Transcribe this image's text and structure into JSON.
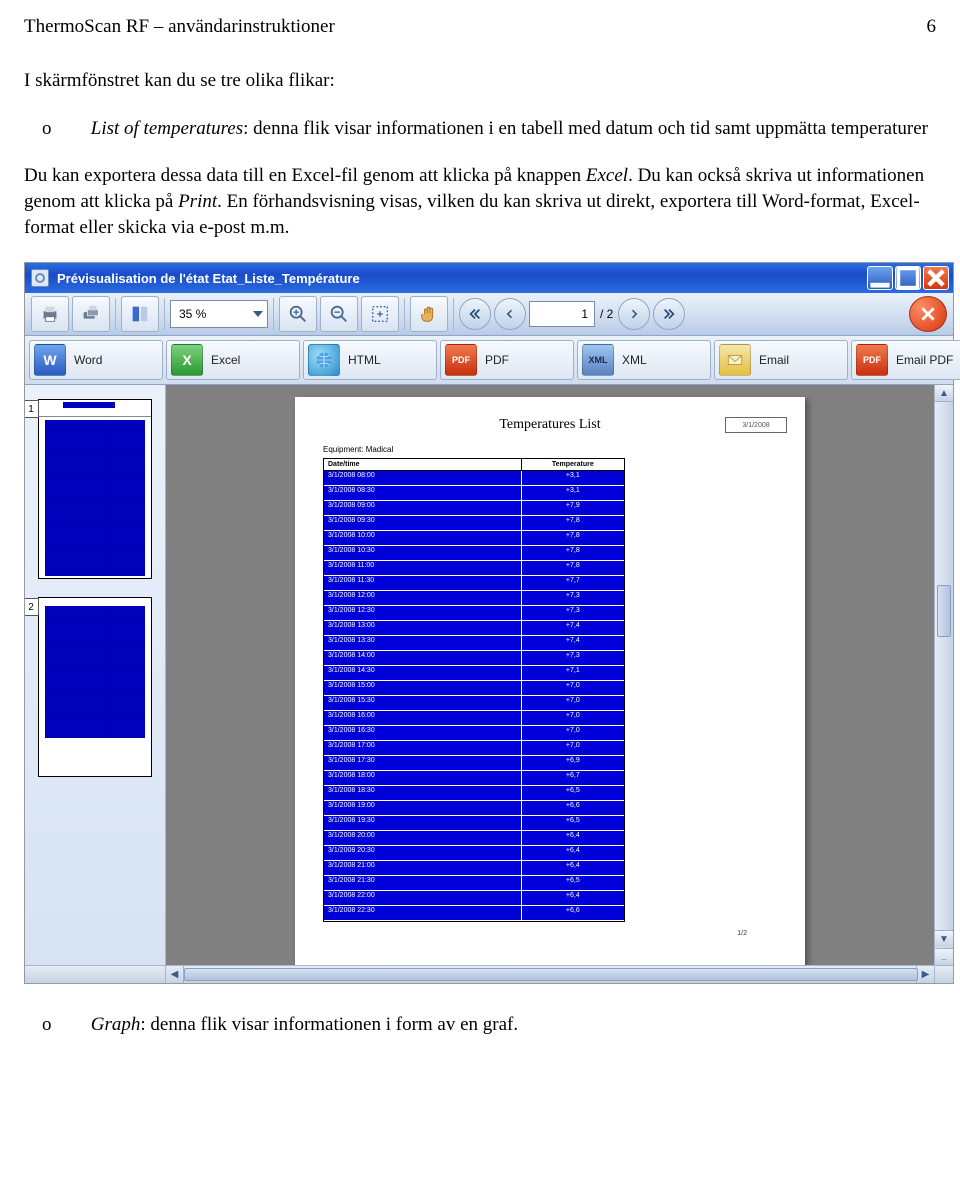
{
  "doc": {
    "header_left": "ThermoScan RF – användarinstruktioner",
    "header_right": "6",
    "intro": "I skärmfönstret kan du se tre olika flikar:",
    "bullet1_prefix": "o",
    "bullet1_label": "List of temperatures",
    "bullet1_rest": ": denna flik visar informationen i en tabell med datum och tid samt uppmätta temperaturer",
    "middle_part1": "Du kan exportera dessa data till en Excel-fil genom att klicka på knappen ",
    "middle_em1": "Excel",
    "middle_part2": ". Du kan också skriva ut informationen genom att klicka på ",
    "middle_em2": "Print",
    "middle_part3": ". En förhandsvisning visas, vilken du kan skriva ut direkt, exportera till Word-format, Excel-format eller skicka via e-post m.m.",
    "bullet2_prefix": "o",
    "bullet2_label": "Graph",
    "bullet2_rest": ": denna flik visar informationen i form av en graf."
  },
  "app": {
    "title": "Prévisualisation de l'état Etat_Liste_Température",
    "toolbar": {
      "zoom": "35 %",
      "page_current": "1",
      "page_suffix": "/ 2"
    },
    "export": {
      "word": "Word",
      "excel": "Excel",
      "html": "HTML",
      "pdf": "PDF",
      "xml": "XML",
      "email": "Email",
      "email_pdf": "Email PDF"
    },
    "thumbs": {
      "p1": "1",
      "p2": "2"
    },
    "preview": {
      "title": "Temperatures List",
      "corner": "3/1/2008",
      "subtitle": "Equipment: Madical",
      "col1": "Date/time",
      "col2": "Temperature",
      "rows": [
        {
          "dt": "3/1/2008 08:00",
          "t": "+3,1"
        },
        {
          "dt": "3/1/2008 08:30",
          "t": "+3,1"
        },
        {
          "dt": "3/1/2008 09:00",
          "t": "+7,9"
        },
        {
          "dt": "3/1/2008 09:30",
          "t": "+7,8"
        },
        {
          "dt": "3/1/2008 10:00",
          "t": "+7,8"
        },
        {
          "dt": "3/1/2008 10:30",
          "t": "+7,8"
        },
        {
          "dt": "3/1/2008 11:00",
          "t": "+7,8"
        },
        {
          "dt": "3/1/2008 11:30",
          "t": "+7,7"
        },
        {
          "dt": "3/1/2008 12:00",
          "t": "+7,3"
        },
        {
          "dt": "3/1/2008 12:30",
          "t": "+7,3"
        },
        {
          "dt": "3/1/2008 13:00",
          "t": "+7,4"
        },
        {
          "dt": "3/1/2008 13:30",
          "t": "+7,4"
        },
        {
          "dt": "3/1/2008 14:00",
          "t": "+7,3"
        },
        {
          "dt": "3/1/2008 14:30",
          "t": "+7,1"
        },
        {
          "dt": "3/1/2008 15:00",
          "t": "+7,0"
        },
        {
          "dt": "3/1/2008 15:30",
          "t": "+7,0"
        },
        {
          "dt": "3/1/2008 16:00",
          "t": "+7,0"
        },
        {
          "dt": "3/1/2008 16:30",
          "t": "+7,0"
        },
        {
          "dt": "3/1/2008 17:00",
          "t": "+7,0"
        },
        {
          "dt": "3/1/2008 17:30",
          "t": "+6,9"
        },
        {
          "dt": "3/1/2008 18:00",
          "t": "+6,7"
        },
        {
          "dt": "3/1/2008 18:30",
          "t": "+6,5"
        },
        {
          "dt": "3/1/2008 19:00",
          "t": "+6,6"
        },
        {
          "dt": "3/1/2008 19:30",
          "t": "+6,5"
        },
        {
          "dt": "3/1/2008 20:00",
          "t": "+6,4"
        },
        {
          "dt": "3/1/2008 20:30",
          "t": "+6,4"
        },
        {
          "dt": "3/1/2008 21:00",
          "t": "+6,4"
        },
        {
          "dt": "3/1/2008 21:30",
          "t": "+6,5"
        },
        {
          "dt": "3/1/2008 22:00",
          "t": "+6,4"
        },
        {
          "dt": "3/1/2008 22:30",
          "t": "+6,6"
        }
      ],
      "footer": "1/2"
    }
  }
}
